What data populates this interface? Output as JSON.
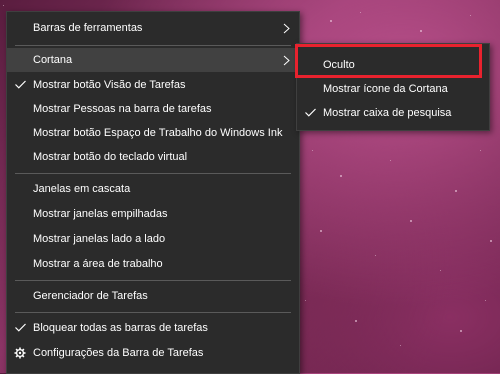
{
  "main_menu": {
    "toolbars": "Barras de ferramentas",
    "cortana": "Cortana",
    "task_view": "Mostrar botão Visão de Tarefas",
    "people": "Mostrar Pessoas na barra de tarefas",
    "ink_workspace": "Mostrar botão Espaço de Trabalho do Windows Ink",
    "touch_keyboard": "Mostrar botão do teclado virtual",
    "cascade": "Janelas em cascata",
    "stacked": "Mostrar janelas empilhadas",
    "side_by_side": "Mostrar janelas lado a lado",
    "desktop": "Mostrar a área de trabalho",
    "task_manager": "Gerenciador de Tarefas",
    "lock_taskbars": "Bloquear todas as barras de tarefas",
    "settings": "Configurações da Barra de Tarefas"
  },
  "cortana_submenu": {
    "hidden": "Oculto",
    "show_icon": "Mostrar ícone da Cortana",
    "show_search_box": "Mostrar caixa de pesquisa"
  },
  "checked": {
    "task_view": true,
    "lock_taskbars": true,
    "show_search_box": true
  },
  "colors": {
    "menu_bg": "#2b2b2b",
    "hover_bg": "#414141",
    "highlight_box": "#e8222e",
    "text": "#ffffff"
  },
  "icons": [
    "chevron-right-icon",
    "checkmark-icon",
    "gear-icon"
  ]
}
